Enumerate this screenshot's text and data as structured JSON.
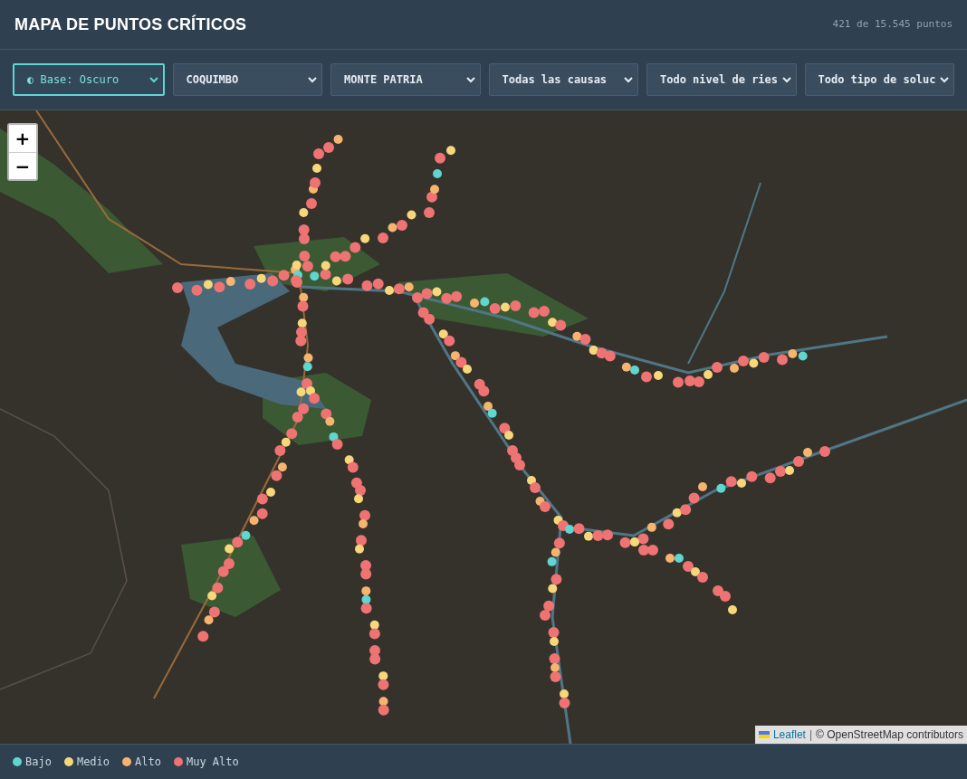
{
  "header": {
    "title": "MAPA DE PUNTOS CRÍTICOS",
    "count": "421 de 15.545 puntos"
  },
  "filters": [
    {
      "label": "◐ Base: Oscuro",
      "active": true
    },
    {
      "label": "COQUIMBO",
      "active": false
    },
    {
      "label": "MONTE PATRIA",
      "active": false
    },
    {
      "label": "Todas las causas",
      "active": false
    },
    {
      "label": "Todo nivel de ries",
      "active": false
    },
    {
      "label": "Todo tipo de soluc",
      "active": false
    }
  ],
  "map": {
    "zoom_in": "+",
    "zoom_out": "−",
    "attribution": {
      "link": "Leaflet",
      "separator": "|",
      "text": "© OpenStreetMap contributors"
    }
  },
  "legend": [
    {
      "label": "Bajo",
      "color": "#5fd6cf"
    },
    {
      "label": "Medio",
      "color": "#f8d77a"
    },
    {
      "label": "Alto",
      "color": "#f6b46e"
    },
    {
      "label": "Muy Alto",
      "color": "#ef7373"
    }
  ]
}
